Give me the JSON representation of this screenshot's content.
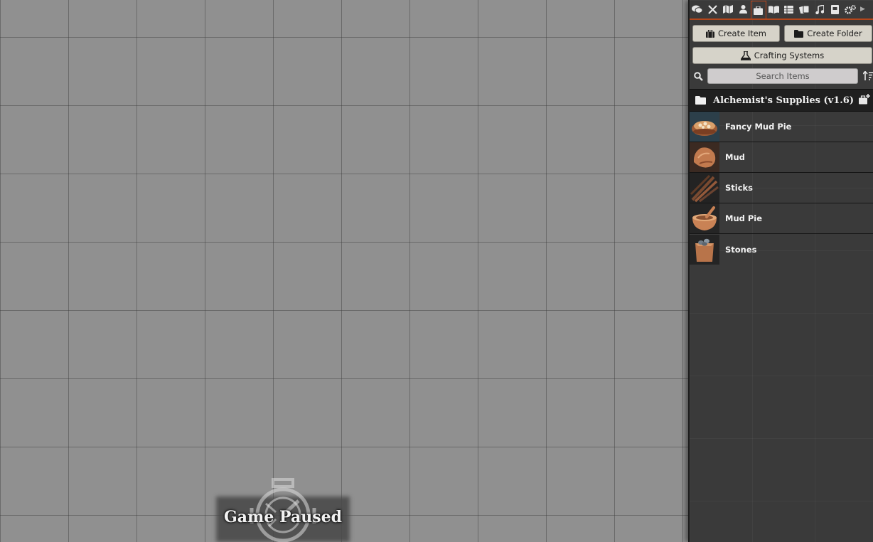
{
  "canvas": {
    "pause_label": "Game Paused"
  },
  "sidebar": {
    "tabs": [
      {
        "name": "chat-tab",
        "icon": "comments-icon"
      },
      {
        "name": "combat-tab",
        "icon": "crossed-swords-icon"
      },
      {
        "name": "scenes-tab",
        "icon": "map-icon"
      },
      {
        "name": "actors-tab",
        "icon": "user-icon"
      },
      {
        "name": "items-tab",
        "icon": "suitcase-icon",
        "active": true
      },
      {
        "name": "journal-tab",
        "icon": "book-open-icon"
      },
      {
        "name": "tables-tab",
        "icon": "th-list-icon"
      },
      {
        "name": "cards-tab",
        "icon": "cards-icon"
      },
      {
        "name": "playlists-tab",
        "icon": "music-icon"
      },
      {
        "name": "compendium-tab",
        "icon": "atlas-icon"
      },
      {
        "name": "settings-tab",
        "icon": "cogs-icon"
      }
    ],
    "accent_color": "#b3461b",
    "create_item_label": "Create Item",
    "create_folder_label": "Create Folder",
    "crafting_systems_label": "Crafting Systems",
    "search_placeholder": "Search Items",
    "folder": {
      "name": "Alchemist's Supplies (v1.6)"
    },
    "items": [
      {
        "name": "Fancy Mud Pie",
        "icon": "fancy-mud-pie-thumbnail"
      },
      {
        "name": "Mud",
        "icon": "mud-thumbnail"
      },
      {
        "name": "Sticks",
        "icon": "sticks-thumbnail"
      },
      {
        "name": "Mud Pie",
        "icon": "mud-pie-thumbnail"
      },
      {
        "name": "Stones",
        "icon": "stones-thumbnail"
      }
    ]
  }
}
